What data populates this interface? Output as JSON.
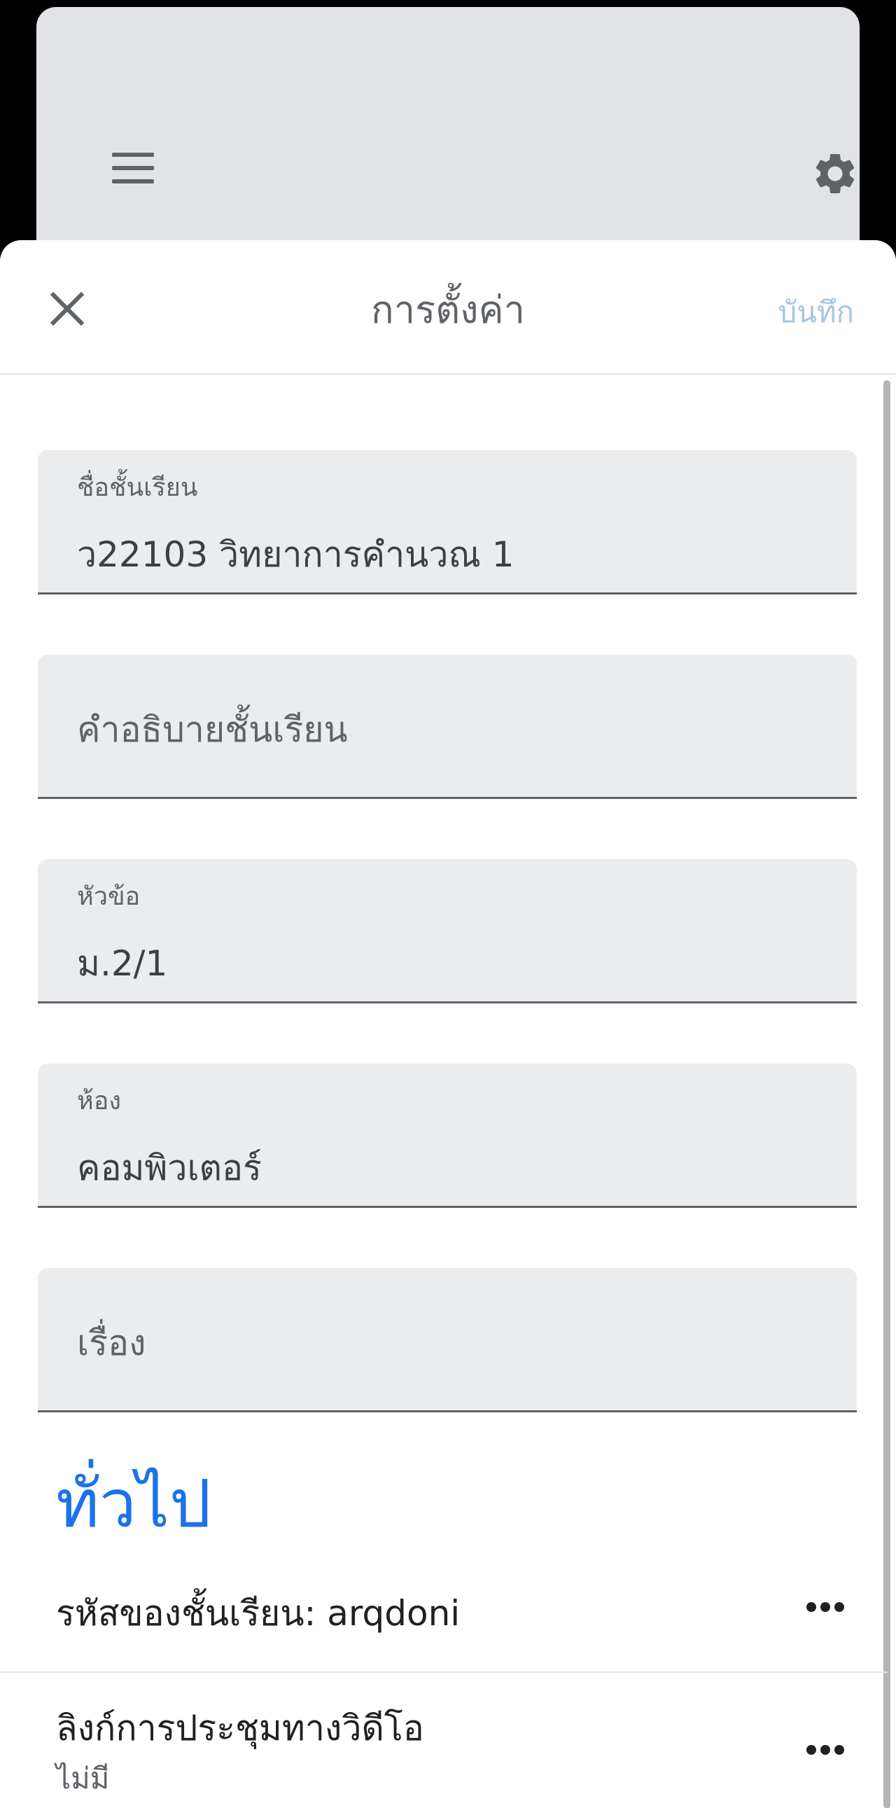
{
  "header": {
    "title": "การตั้งค่า",
    "save_label": "บันทึก"
  },
  "fields": {
    "class_name": {
      "label": "ชื่อชั้นเรียน",
      "value": "ว22103 วิทยาการคำนวณ 1"
    },
    "description": {
      "placeholder": "คำอธิบายชั้นเรียน"
    },
    "section": {
      "label": "หัวข้อ",
      "value": "ม.2/1"
    },
    "room": {
      "label": "ห้อง",
      "value": "คอมพิวเตอร์"
    },
    "subject": {
      "placeholder": "เรื่อง"
    }
  },
  "general": {
    "title": "ทั่วไป",
    "class_code": "รหัสของชั้นเรียน: arqdoni",
    "meet_link_label": "ลิงก์การประชุมทางวิดีโอ",
    "meet_link_value": "ไม่มี"
  },
  "icons": [
    "menu-icon",
    "gear-icon",
    "close-icon",
    "more-icon"
  ],
  "colors": {
    "accent": "#1a73e8",
    "save_disabled": "#a8c3e8",
    "field_bg": "#ebecee"
  }
}
